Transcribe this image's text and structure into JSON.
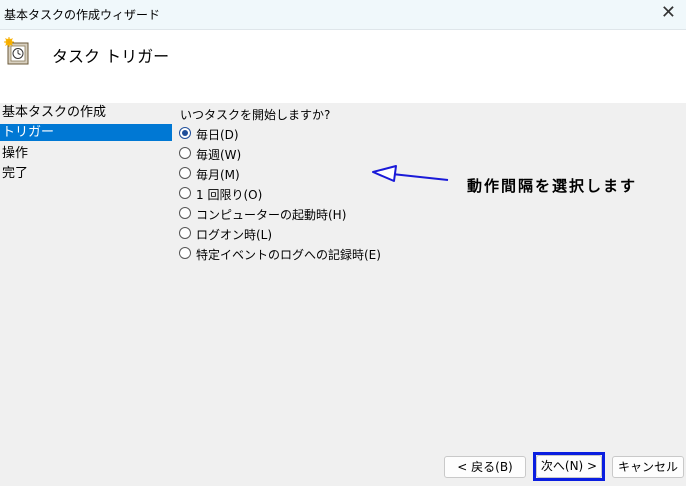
{
  "window": {
    "title": "基本タスクの作成ウィザード"
  },
  "header": {
    "title": "タスク トリガー"
  },
  "nav": {
    "items": [
      {
        "label": "基本タスクの作成",
        "selected": false
      },
      {
        "label": "トリガー",
        "selected": true
      },
      {
        "label": "操作",
        "selected": false
      },
      {
        "label": "完了",
        "selected": false
      }
    ]
  },
  "trigger": {
    "question": "いつタスクを開始しますか?",
    "options": [
      {
        "label": "毎日(D)",
        "checked": true
      },
      {
        "label": "毎週(W)",
        "checked": false
      },
      {
        "label": "毎月(M)",
        "checked": false
      },
      {
        "label": "1 回限り(O)",
        "checked": false
      },
      {
        "label": "コンピューターの起動時(H)",
        "checked": false
      },
      {
        "label": "ログオン時(L)",
        "checked": false
      },
      {
        "label": "特定イベントのログへの記録時(E)",
        "checked": false
      }
    ]
  },
  "annotation": {
    "text": "動作間隔を選択します",
    "color": "#1a1ad8"
  },
  "buttons": {
    "back": "< 戻る(B)",
    "next": "次へ(N) >",
    "cancel": "キャンセル"
  }
}
